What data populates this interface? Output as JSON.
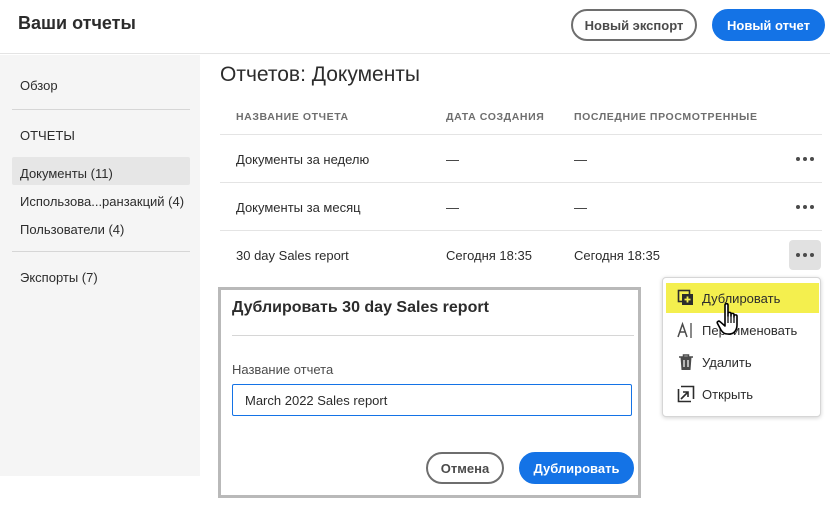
{
  "header": {
    "title": "Ваши отчеты",
    "new_export_label": "Новый экспорт",
    "new_report_label": "Новый отчет"
  },
  "sidebar": {
    "overview": "Обзор",
    "reports_section": "ОТЧЕТЫ",
    "items": [
      {
        "label": "Документы (11)",
        "selected": true
      },
      {
        "label": "Использова...ранзакций (4)",
        "selected": false
      },
      {
        "label": "Пользователи (4)",
        "selected": false
      }
    ],
    "exports": "Экспорты (7)"
  },
  "main": {
    "title": "Отчетов: Документы",
    "columns": [
      "НАЗВАНИЕ ОТЧЕТА",
      "ДАТА СОЗДАНИЯ",
      "ПОСЛЕДНИЕ ПРОСМОТРЕННЫЕ"
    ],
    "rows": [
      {
        "name": "Документы за неделю",
        "created": "—",
        "viewed": "—"
      },
      {
        "name": "Документы за месяц",
        "created": "—",
        "viewed": "—"
      },
      {
        "name": "30 day Sales report",
        "created": "Сегодня 18:35",
        "viewed": "Сегодня 18:35"
      }
    ]
  },
  "menu": {
    "items": [
      {
        "label": "Дублировать",
        "icon": "duplicate-icon",
        "highlighted": true
      },
      {
        "label": "Переименовать",
        "icon": "rename-icon",
        "highlighted": false
      },
      {
        "label": "Удалить",
        "icon": "trash-icon",
        "highlighted": false
      },
      {
        "label": "Открыть",
        "icon": "open-icon",
        "highlighted": false
      }
    ]
  },
  "dialog": {
    "title": "Дублировать 30 day Sales report",
    "field_label": "Название отчета",
    "field_value": "March 2022 Sales report",
    "cancel_label": "Отмена",
    "confirm_label": "Дублировать"
  },
  "colors": {
    "accent": "#1473e6",
    "highlight": "#f4ef4e",
    "sidebar_bg": "#f5f5f5"
  }
}
